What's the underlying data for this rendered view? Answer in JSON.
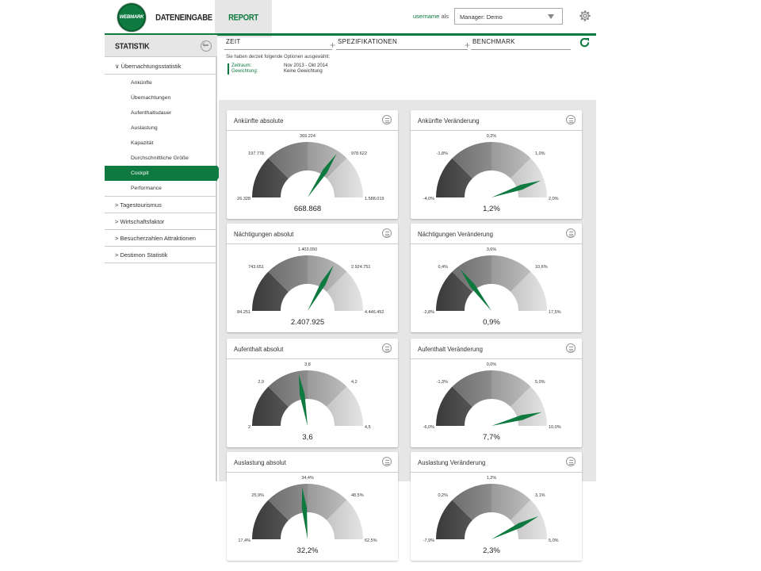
{
  "header": {
    "logo_text": "WEBMARK",
    "nav": {
      "dateneingabe": "DATENEINGABE",
      "report": "REPORT"
    },
    "username": "username",
    "als": "als",
    "manager_select": "Manager: Demo"
  },
  "sidebar": {
    "title": "STATISTIK",
    "sections": [
      {
        "label": "∨ Übernachtungsstatistik"
      },
      {
        "label": "> Tagestourismus"
      },
      {
        "label": "> Wirtschaftsfaktor"
      },
      {
        "label": "> Besucherzahlen Attraktionen"
      },
      {
        "label": "> Destimon Statistik"
      }
    ],
    "items": [
      {
        "label": "Ankünfte"
      },
      {
        "label": "Übernachtungen"
      },
      {
        "label": "Aufenthaltsdauer"
      },
      {
        "label": "Auslastung"
      },
      {
        "label": "Kapazität"
      },
      {
        "label": "Durchschnittliche Größe"
      },
      {
        "label": "Cockpit",
        "active": true
      },
      {
        "label": "Performance"
      }
    ]
  },
  "filters": {
    "tabs": [
      "ZEIT",
      "SPEZIFIKATIONEN",
      "BENCHMARK"
    ],
    "info": "Sie haben derzeit folgende Optionen ausgewählt:",
    "zeitraum_label": "Zeitraum:",
    "zeitraum_value": "Nov 2013 - Okt 2014",
    "gewichtung_label": "Gewichtung:",
    "gewichtung_value": "Keine Gewichtung"
  },
  "colors": {
    "accent": "#0e7a3f"
  },
  "gauges": [
    {
      "title": "Ankünfte absolute",
      "ticks": [
        "26.328",
        "197.778",
        "369.224",
        "978.622",
        "1.588.019"
      ],
      "value": "668.868",
      "needle": 0.686
    },
    {
      "title": "Ankünfte Veränderung",
      "ticks": [
        "-4,0%",
        "-1,8%",
        "0,2%",
        "1,0%",
        "2,0%"
      ],
      "value": "1,2%",
      "needle": 0.895
    },
    {
      "title": "Nächtigungen absolut",
      "ticks": [
        "84.251",
        "743.651",
        "1.403.050",
        "2.924.751",
        "4.446.452"
      ],
      "value": "2.407.925",
      "needle": 0.665
    },
    {
      "title": "Nächtigungen Veränderung",
      "ticks": [
        "-2,8%",
        "0,4%",
        "3,6%",
        "10,6%",
        "17,5%"
      ],
      "value": "0,9%",
      "needle": 0.295
    },
    {
      "title": "Aufenthalt absolut",
      "ticks": [
        "2",
        "2,9",
        "3,8",
        "4,2",
        "4,5"
      ],
      "value": "3,6",
      "needle": 0.446
    },
    {
      "title": "Aufenthalt Veränderung",
      "ticks": [
        "-6,0%",
        "-1,3%",
        "0,0%",
        "5,0%",
        "10,0%"
      ],
      "value": "7,7%",
      "needle": 0.915
    },
    {
      "title": "Auslastung absolut",
      "ticks": [
        "17,4%",
        "25,9%",
        "34,4%",
        "48,5%",
        "62,5%"
      ],
      "value": "32,2%",
      "needle": 0.467
    },
    {
      "title": "Auslastung Veränderung",
      "ticks": [
        "-7,9%",
        "0,2%",
        "1,2%",
        "3,1%",
        "5,0%"
      ],
      "value": "2,3%",
      "needle": 0.855
    }
  ]
}
